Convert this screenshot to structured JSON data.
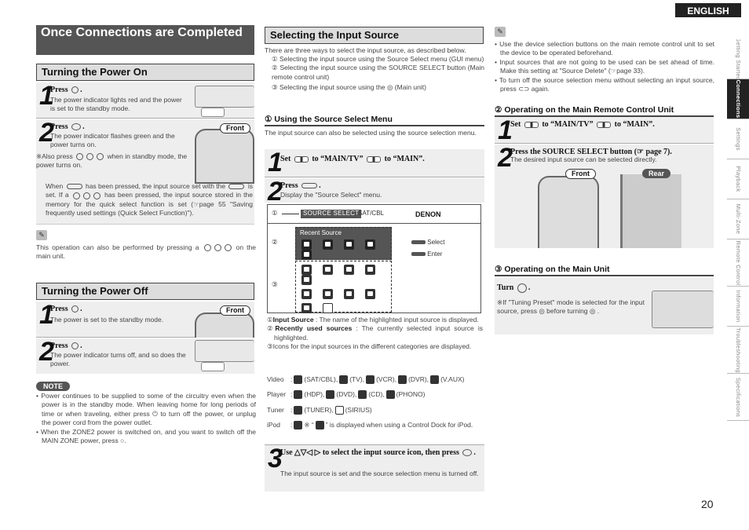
{
  "header": {
    "language": "ENGLISH"
  },
  "side_tabs": [
    {
      "label": "Getting Started",
      "active": false
    },
    {
      "label": "Connections",
      "active": true
    },
    {
      "label": "Settings",
      "active": false
    },
    {
      "label": "Playback",
      "active": false
    },
    {
      "label": "Multi-Zone",
      "active": false
    },
    {
      "label": "Remote Control",
      "active": false
    },
    {
      "label": "Information",
      "active": false
    },
    {
      "label": "Troubleshooting",
      "active": false
    },
    {
      "label": "Specifications",
      "active": false
    }
  ],
  "page_number": "20",
  "left": {
    "main_title": "Once Connections are Completed",
    "power_on": {
      "title": "Turning the Power On",
      "step1": {
        "num": "1",
        "head": "Press",
        "icon": "power-on-off-button",
        "body": "The power indicator lights red and the power is set to the standby mode."
      },
      "step2": {
        "num": "2",
        "head": "Press",
        "icon": "on-source-button",
        "body": "The power indicator flashes green and the power turns on.",
        "also": "※Also press",
        "also_tail": "when in standby mode, the power turns on.",
        "front_label": "Front",
        "when_1": "When",
        "when_2": "has been pressed, the input source set with the",
        "when_3": "is set. If a",
        "when_4": "has been pressed, the input source stored in the memory for the quick select function is set (☞page 55 \"Saving frequently used settings (Quick Select Function)\")."
      },
      "memo": "This operation can also be performed by pressing a",
      "memo_tail": "on the main unit."
    },
    "power_off": {
      "title": "Turning the Power Off",
      "step1": {
        "num": "1",
        "head": "Press",
        "icon": "off-button",
        "body": "The power is set to the standby mode.",
        "front_label": "Front"
      },
      "step2": {
        "num": "2",
        "head": "Press",
        "icon": "power-on-off-button",
        "body": "The power indicator turns off, and so does the power."
      }
    },
    "note": {
      "label": "NOTE",
      "items": [
        "Power continues to be supplied to some of the circuitry even when the power is in the standby mode. When leaving home for long periods of time or when traveling, either press ⏻ to turn off the power, or unplug the power cord from the power outlet.",
        "When the ZONE2 power is switched on, and you want to switch off the MAIN ZONE power, press ○."
      ]
    }
  },
  "middle": {
    "title": "Selecting the Input Source",
    "intro": "There are three ways to select the input source, as described below.",
    "ways": [
      "① Selecting the input source using the Source Select menu (GUI menu)",
      "② Selecting the input source using the SOURCE SELECT button (Main remote control unit)",
      "③ Selecting the input source using the ◎ (Main unit)"
    ],
    "sub1": {
      "title": "① Using the Source Select Menu",
      "desc": "The input source can also be selected using the source selection menu.",
      "step1": {
        "num": "1",
        "text_a": "Set",
        "text_b": "to “MAIN/TV”",
        "text_c": "to “MAIN”."
      },
      "step2": {
        "num": "2",
        "head": "Press",
        "body": "Display the \"Source Select\" menu."
      },
      "menu": {
        "marker1": "①",
        "marker2": "②",
        "marker3": "③",
        "source_tag": "SOURCE SELECT",
        "source_value": ":SAT/CBL",
        "brand": "DENON",
        "recent_label": "Recent Source",
        "select_label": "Select",
        "enter_label": "Enter"
      },
      "legend": [
        {
          "num": "①",
          "bold": "Input Source",
          "text": " : The name of the highlighted input source is displayed."
        },
        {
          "num": "②",
          "bold": "Recently used sources",
          "text": " : The currently selected input source is highlighted."
        },
        {
          "num": "③",
          "bold": "",
          "text": "Icons for the input sources in the different categories are displayed."
        }
      ],
      "categories": [
        {
          "name": "Video",
          "items": [
            "(SAT/CBL),",
            "(TV),",
            "(VCR),",
            "(DVR),",
            "(V.AUX)"
          ]
        },
        {
          "name": "Player",
          "items": [
            "(HDP),",
            "(DVD),",
            "(CD),",
            "(PHONO)"
          ]
        },
        {
          "name": "Tuner",
          "items": [
            "(TUNER),",
            "(SIRIUS)"
          ]
        },
        {
          "name": "iPod",
          "items": [
            "※ “",
            "” is displayed when using a Control Dock for iPod."
          ]
        }
      ],
      "step3": {
        "num": "3",
        "head": "Use △▽◁ ▷ to select the input source icon, then press",
        "body": "The input source is set and the source selection menu is turned off."
      }
    }
  },
  "right": {
    "memo_items": [
      "Use the device selection buttons on the main remote control unit to set the device to be operated beforehand.",
      "Input sources that are not going to be used can be set ahead of time. Make this setting at \"Source Delete\" (☞page 33).",
      "To turn off the source selection menu without selecting an input source, press ⊂⊃ again."
    ],
    "sub2": {
      "title": "② Operating on the Main Remote Control Unit",
      "step1": {
        "num": "1",
        "text_a": "Set",
        "text_b": "to “MAIN/TV”",
        "text_c": "to “MAIN”."
      },
      "step2": {
        "num": "2",
        "head": "Press the SOURCE SELECT button (☞ page 7).",
        "body": "The desired input source can be selected directly.",
        "front_label": "Front",
        "rear_label": "Rear"
      }
    },
    "sub3": {
      "title": "③ Operating on the Main Unit",
      "head": "Turn",
      "note": "※If \"Tuning Preset\" mode is selected for the input source, press ◎ before turning ◎ ."
    }
  }
}
